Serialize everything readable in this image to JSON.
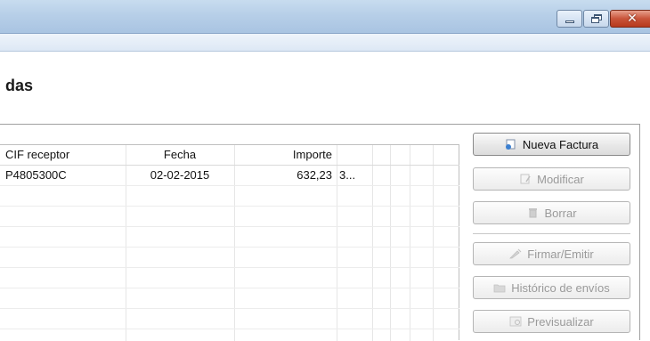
{
  "window": {
    "controls": [
      {
        "icon": "minimize-icon"
      },
      {
        "icon": "restore-icon"
      },
      {
        "icon": "close-icon",
        "glyph": "✕",
        "color": "#c9543a"
      }
    ]
  },
  "page": {
    "heading": "das"
  },
  "table": {
    "columns": [
      "CIF receptor",
      "Fecha",
      "Importe",
      ""
    ],
    "rows": [
      {
        "cif": "P4805300C",
        "fecha": "02-02-2015",
        "importe": "632,23",
        "extra": "3..."
      }
    ]
  },
  "actions": {
    "nueva_factura": "Nueva Factura",
    "modificar": "Modificar",
    "borrar": "Borrar",
    "firmar_emitir": "Firmar/Emitir",
    "historico": "Histórico de envíos",
    "previsualizar": "Previsualizar"
  },
  "colors": {
    "titlebar": "#b7cfe8",
    "disabled_text": "#9a9a9a",
    "grid_line": "#e6e6e6"
  }
}
